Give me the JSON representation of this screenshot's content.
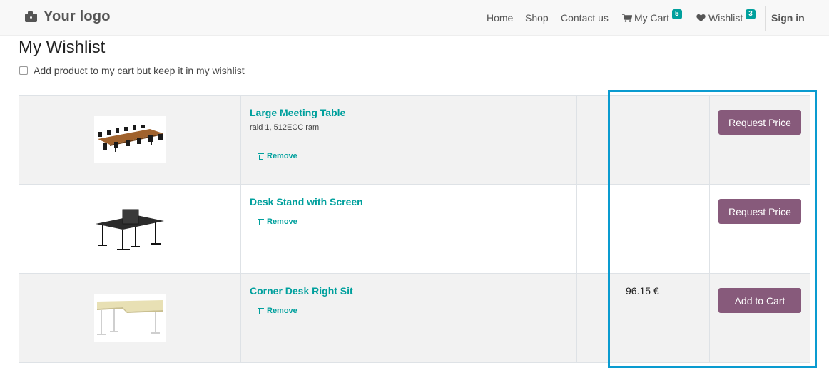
{
  "header": {
    "logo_icon": "camera-icon",
    "logo_text": "Your logo",
    "nav": [
      {
        "label": "Home"
      },
      {
        "label": "Shop"
      },
      {
        "label": "Contact us"
      }
    ],
    "cart": {
      "icon": "shopping-cart-icon",
      "label": "My Cart",
      "count": "5"
    },
    "wishlist": {
      "icon": "heart-icon",
      "label": "Wishlist",
      "count": "3"
    },
    "signin": "Sign in"
  },
  "page": {
    "title": "My Wishlist",
    "keep_in_wishlist_label": "Add product to my cart but keep it in my wishlist"
  },
  "wishlist": [
    {
      "name": "Large Meeting Table",
      "description": "raid 1, 512ECC ram",
      "remove_label": "Remove",
      "price": "",
      "action_label": "Request Price"
    },
    {
      "name": "Desk Stand with Screen",
      "description": "",
      "remove_label": "Remove",
      "price": "",
      "action_label": "Request Price"
    },
    {
      "name": "Corner Desk Right Sit",
      "description": "",
      "remove_label": "Remove",
      "price": "96.15 €",
      "action_label": "Add to Cart"
    }
  ],
  "colors": {
    "accent": "#00a09d",
    "button": "#875a7b",
    "highlight": "#0a9bd0"
  }
}
